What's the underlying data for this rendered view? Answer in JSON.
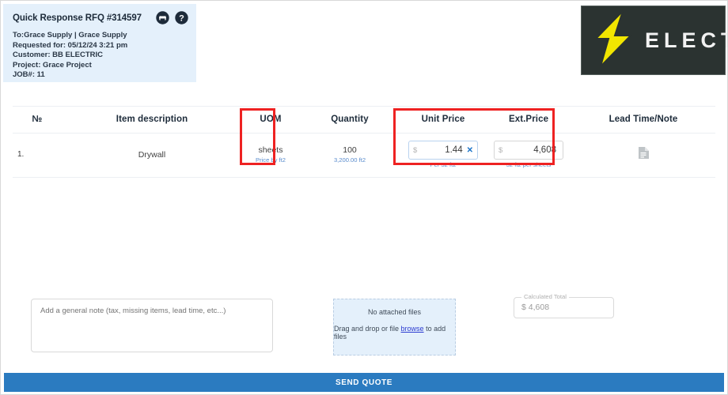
{
  "header": {
    "title": "Quick Response RFQ #314597",
    "lines": [
      "To:Grace Supply | Grace Supply",
      "Requested for: 05/12/24 3:21 pm",
      "Customer: BB ELECTRIC",
      "Project: Grace Project",
      "JOB#: 11"
    ],
    "icons": [
      {
        "name": "print-icon",
        "glyph": "⊖"
      },
      {
        "name": "help-icon",
        "glyph": "?"
      }
    ]
  },
  "logo": {
    "word": "ELECTRIC",
    "bolt_color": "#f2e600",
    "background": "#2b3331"
  },
  "table": {
    "columns": [
      "№",
      "Item description",
      "UOM",
      "Quantity",
      "Unit Price",
      "Ext.Price",
      "Lead Time/Note"
    ],
    "rows": [
      {
        "no": "1.",
        "description": "Drywall",
        "uom": "sheets",
        "uom_sub": "Price by ft2",
        "quantity": "100",
        "quantity_sub": "3,200.00 ft2",
        "unit_price_currency": "$",
        "unit_price": "1.44",
        "unit_price_sub": "Per 32 ft2",
        "unit_price_clear": "✕",
        "ext_price_currency": "$",
        "ext_price": "4,608",
        "ext_price_sub": "32 ft2 per sheets",
        "lead_note_icon": "note-icon"
      }
    ]
  },
  "bottom": {
    "note_placeholder": "Add a general note (tax, missing items, lead time, etc...)",
    "note_value": "",
    "files_title": "No attached files",
    "files_prefix": "Drag and drop or file ",
    "files_link": "browse",
    "files_suffix": " to add files",
    "total_label": "Calculated Total",
    "total_currency": "$",
    "total_value": "4,608",
    "send_label": "SEND QUOTE"
  },
  "colors": {
    "accent_blue": "#2b7bc0",
    "panel_blue": "#e4f0fb",
    "annotation_red": "#ee2222",
    "sub_text_blue": "#5a8ccd"
  }
}
